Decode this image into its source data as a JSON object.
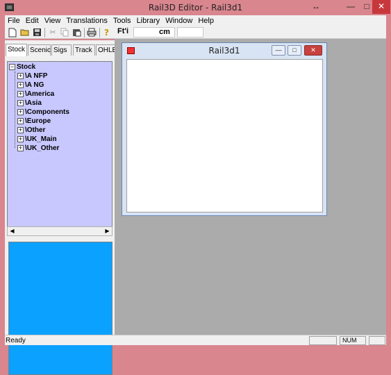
{
  "window": {
    "title": "Rail3D Editor - Rail3d1",
    "resize_glyph": "↔",
    "min_glyph": "—",
    "max_glyph": "□",
    "close_glyph": "✕"
  },
  "menu": [
    "File",
    "Edit",
    "View",
    "Translations",
    "Tools",
    "Library",
    "Window",
    "Help"
  ],
  "toolbar": {
    "ft_label": "Ft'i",
    "unit_label": "cm",
    "icons": [
      "new-file-icon",
      "open-folder-icon",
      "save-icon",
      "cut-icon",
      "copy-icon",
      "paste-icon",
      "print-icon",
      "help-icon"
    ]
  },
  "tabs": [
    "Stock",
    "Scenic",
    "Sigs",
    "Track",
    "OHLE"
  ],
  "tree": {
    "root": "Stock",
    "items": [
      "\\A NFP",
      "\\A NG",
      "\\America",
      "\\Asia",
      "\\Components",
      "\\Europe",
      "\\Other",
      "\\UK_Main",
      "\\UK_Other"
    ],
    "expand_glyph": "+",
    "collapse_glyph": "−"
  },
  "scroll": {
    "left": "◀",
    "right": "▶"
  },
  "child_window": {
    "title": "Rail3d1"
  },
  "status": {
    "text": "Ready",
    "num": "NUM"
  },
  "colors": {
    "tree_bg": "#c8c8ff",
    "preview_bg": "#0aa1ff",
    "mdi_bg": "#ababab",
    "frame": "#d9868e"
  }
}
